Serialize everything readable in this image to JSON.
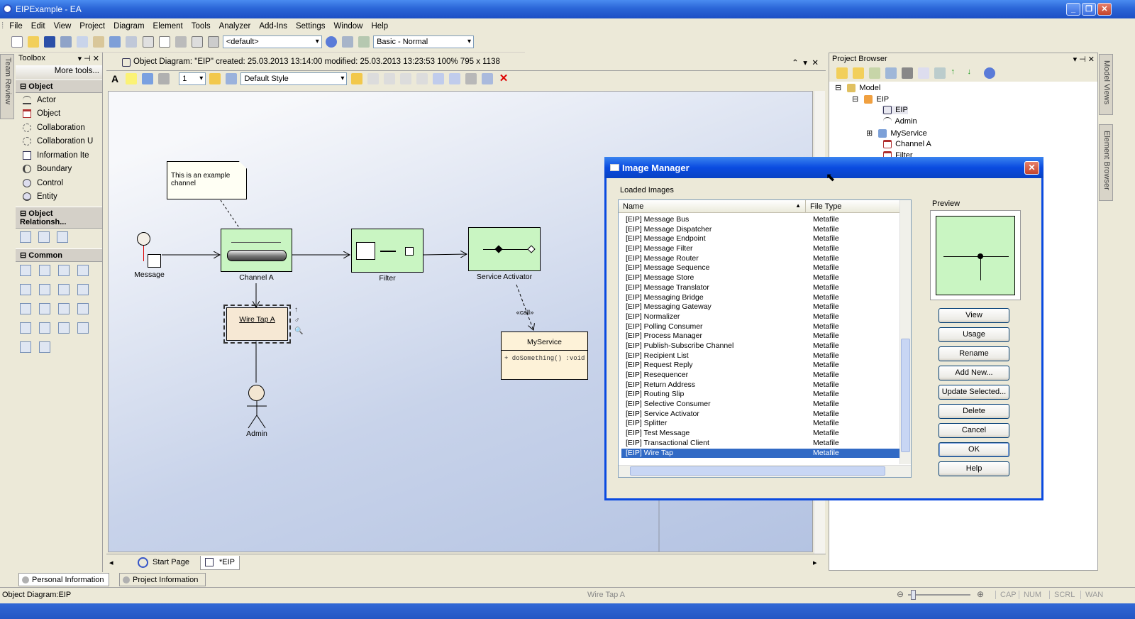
{
  "window": {
    "title": "EIPExample - EA"
  },
  "menu": [
    "File",
    "Edit",
    "View",
    "Project",
    "Diagram",
    "Element",
    "Tools",
    "Analyzer",
    "Add-Ins",
    "Settings",
    "Window",
    "Help"
  ],
  "toolbar": {
    "perspective": "<default>",
    "workspace": "Basic - Normal"
  },
  "left_tabs": [
    "Team Review"
  ],
  "right_tabs": [
    "Model Views",
    "Element Browser"
  ],
  "toolbox": {
    "title": "Toolbox",
    "more_tools": "More tools...",
    "sections": [
      {
        "name": "Object",
        "items": [
          "Actor",
          "Object",
          "Collaboration",
          "Collaboration U",
          "Information Ite",
          "Boundary",
          "Control",
          "Entity"
        ]
      },
      {
        "name": "Object Relationsh...",
        "items": []
      },
      {
        "name": "Common",
        "items": []
      }
    ]
  },
  "diagram": {
    "header": "Object Diagram: \"EIP\"   created: 25.03.2013 13:14:00  modified: 25.03.2013 13:23:53   100%   795 x 1138",
    "style": "Default Style",
    "line_width": "1",
    "note": "This is an example channel",
    "elements": {
      "message": "Message",
      "channel": "Channel A",
      "filter": "Filter",
      "activator": "Service Activator",
      "wiretap": "Wire Tap A",
      "admin": "Admin",
      "service": "MyService",
      "operation": "+ doSomething() :void",
      "stereotype": "«call»"
    },
    "tabs": [
      "Start Page",
      "*EIP"
    ]
  },
  "project_browser": {
    "title": "Project Browser",
    "tree": [
      "Model",
      "EIP",
      "EIP",
      "Admin",
      "MyService",
      "Channel A",
      "Filter"
    ]
  },
  "dialog": {
    "title": "Image Manager",
    "loaded_label": "Loaded Images",
    "columns": [
      "Name",
      "File Type"
    ],
    "preview_label": "Preview",
    "rows": [
      [
        "[EIP] Message Bus",
        "Metafile"
      ],
      [
        "[EIP] Message Dispatcher",
        "Metafile"
      ],
      [
        "[EIP] Message Endpoint",
        "Metafile"
      ],
      [
        "[EIP] Message Filter",
        "Metafile"
      ],
      [
        "[EIP] Message Router",
        "Metafile"
      ],
      [
        "[EIP] Message Sequence",
        "Metafile"
      ],
      [
        "[EIP] Message Store",
        "Metafile"
      ],
      [
        "[EIP] Message Translator",
        "Metafile"
      ],
      [
        "[EIP] Messaging Bridge",
        "Metafile"
      ],
      [
        "[EIP] Messaging Gateway",
        "Metafile"
      ],
      [
        "[EIP] Normalizer",
        "Metafile"
      ],
      [
        "[EIP] Polling Consumer",
        "Metafile"
      ],
      [
        "[EIP] Process Manager",
        "Metafile"
      ],
      [
        "[EIP] Publish-Subscribe Channel",
        "Metafile"
      ],
      [
        "[EIP] Recipient List",
        "Metafile"
      ],
      [
        "[EIP] Request Reply",
        "Metafile"
      ],
      [
        "[EIP] Resequencer",
        "Metafile"
      ],
      [
        "[EIP] Return Address",
        "Metafile"
      ],
      [
        "[EIP] Routing Slip",
        "Metafile"
      ],
      [
        "[EIP] Selective Consumer",
        "Metafile"
      ],
      [
        "[EIP] Service Activator",
        "Metafile"
      ],
      [
        "[EIP] Splitter",
        "Metafile"
      ],
      [
        "[EIP] Test Message",
        "Metafile"
      ],
      [
        "[EIP] Transactional Client",
        "Metafile"
      ],
      [
        "[EIP] Wire Tap",
        "Metafile"
      ]
    ],
    "selected_row": "[EIP] Wire Tap",
    "buttons": [
      "View",
      "Usage",
      "Rename",
      "Add New...",
      "Update Selected...",
      "Delete",
      "Cancel",
      "OK",
      "Help"
    ]
  },
  "bottom_tabs": [
    "Personal Information",
    "Project Information"
  ],
  "status": {
    "left": "Object Diagram:EIP",
    "center": "Wire Tap A",
    "indicators": [
      "CAP",
      "NUM",
      "SCRL",
      "WAN"
    ]
  }
}
